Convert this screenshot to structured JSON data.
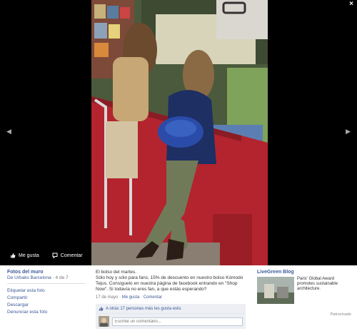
{
  "viewer": {
    "close_label": "×",
    "prev_icon": "chevron-left-icon",
    "next_icon": "chevron-right-icon",
    "actions": {
      "like_label": "Me gusta",
      "comment_label": "Comentar"
    }
  },
  "album": {
    "title": "Fotos del muro",
    "source": "De Urbaks Barcelona",
    "position": " · 4 de 7",
    "options": [
      "Etiquetar esta foto",
      "Compartir",
      "Descargar",
      "Denunciar esta foto"
    ]
  },
  "post": {
    "caption_line1": "El bolso del martes.",
    "caption_line2": "Sólo hoy y sólo para fans, 15% de descuento en nuestro bolso Kómodo Tejus. Consíguelo en nuestra página de facebook entrando en \"Shop Now\". Si todavía no eres fan, a que estás esperando?",
    "date": "17 de mayo",
    "sep1": " · ",
    "like_link": "Me gusta",
    "sep2": " · ",
    "comment_link": "Comentar",
    "likes_text": "A otras 17 personas más les gusta esto.",
    "comment_placeholder": "Escribe un comentario..."
  },
  "ad": {
    "title": "LiveGreen Blog",
    "text": "Paris' Global Award promotes sustainable architecture.",
    "sponsored": "Patrocinado"
  },
  "colors": {
    "link": "#3b5998",
    "viewer_bg": "#000000",
    "kiosk_red": "#b3242e"
  }
}
